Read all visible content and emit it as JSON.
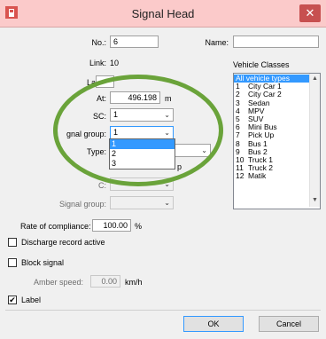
{
  "window": {
    "title": "Signal Head",
    "close_glyph": "✕",
    "close_icon": "close-icon",
    "app_icon": "signal-head-app-icon",
    "accent": "#c75050"
  },
  "form": {
    "no_label": "No.:",
    "no_value": "6",
    "name_label": "Name:",
    "name_value": "",
    "link_label": "Link:",
    "link_value": "10",
    "lane_label": "La",
    "lane_value": "",
    "at_label": "At:",
    "at_value": "496.198",
    "at_unit": "m",
    "sc_label": "SC:",
    "sc_value": "1",
    "signal_group_label": "gnal group:",
    "signal_group_value": "1",
    "signal_group_options": [
      "1",
      "2",
      "3"
    ],
    "type_label": "Type:",
    "fragment_p": "p",
    "sc2_label": "C:",
    "signal_group2_label": "Signal group:",
    "rate_label": "Rate of compliance:",
    "rate_value": "100.00",
    "rate_unit": "%",
    "discharge_label": "Discharge record active",
    "discharge_checked": false,
    "block_label": "Block signal",
    "block_checked": false,
    "amber_label": "Amber speed:",
    "amber_value": "0.00",
    "amber_unit": "km/h",
    "label_label": "Label",
    "label_checked": true,
    "check_glyph": "✔"
  },
  "vehicle_classes": {
    "title": "Vehicle Classes",
    "items": [
      {
        "num": "",
        "name": "All vehicle types",
        "selected": true
      },
      {
        "num": "1",
        "name": "City Car 1"
      },
      {
        "num": "2",
        "name": "City Car 2"
      },
      {
        "num": "3",
        "name": "Sedan"
      },
      {
        "num": "4",
        "name": "MPV"
      },
      {
        "num": "5",
        "name": "SUV"
      },
      {
        "num": "6",
        "name": "Mini Bus"
      },
      {
        "num": "7",
        "name": "Pick Up"
      },
      {
        "num": "8",
        "name": "Bus 1"
      },
      {
        "num": "9",
        "name": "Bus 2"
      },
      {
        "num": "10",
        "name": "Truck 1"
      },
      {
        "num": "11",
        "name": "Truck 2"
      },
      {
        "num": "12",
        "name": "Matik"
      }
    ],
    "scroll_up": "▲",
    "scroll_down": "▼"
  },
  "buttons": {
    "ok": "OK",
    "cancel": "Cancel"
  },
  "glyphs": {
    "chevron": "⌄"
  },
  "annotation": {
    "color": "#6aa33a"
  }
}
